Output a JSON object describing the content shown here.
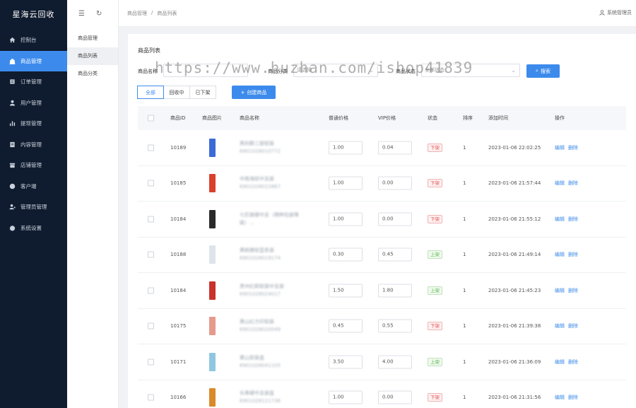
{
  "app": {
    "logo": "星海云回收"
  },
  "sidebar": {
    "items": [
      {
        "label": "控制台",
        "icon": "home-icon",
        "active": false
      },
      {
        "label": "商品管理",
        "icon": "shopping-bag-icon",
        "active": true
      },
      {
        "label": "订单管理",
        "icon": "order-icon",
        "active": false
      },
      {
        "label": "用户管理",
        "icon": "user-icon",
        "active": false
      },
      {
        "label": "提现管理",
        "icon": "bar-chart-icon",
        "active": false
      },
      {
        "label": "内容管理",
        "icon": "document-icon",
        "active": false
      },
      {
        "label": "店铺管理",
        "icon": "store-icon",
        "active": false
      },
      {
        "label": "客户端",
        "icon": "client-icon",
        "active": false
      },
      {
        "label": "管理员管理",
        "icon": "admin-icon",
        "active": false
      },
      {
        "label": "系统设置",
        "icon": "gear-icon",
        "active": false
      }
    ]
  },
  "subnav": {
    "items": [
      {
        "label": "商品管理",
        "active": false
      },
      {
        "label": "商品列表",
        "active": true
      },
      {
        "label": "商品分类",
        "active": false
      }
    ]
  },
  "header": {
    "breadcrumb": [
      "商品管理",
      "/",
      "商品列表"
    ],
    "user": "系统管理员"
  },
  "main": {
    "title": "商品列表",
    "filters": {
      "name_label": "商品名称",
      "category_label": "商品分类",
      "category_placeholder": "请选择",
      "status_label": "商品状态",
      "status_placeholder": "全部状态",
      "search_label": "搜索"
    },
    "watermark": "https://www.huzhan.com/ishop41839",
    "tabs": [
      "全部",
      "回收中",
      "已下架"
    ],
    "create_label": "创建商品",
    "columns": [
      "商品ID",
      "商品图片",
      "商品名称",
      "普通价格",
      "VIP价格",
      "状态",
      "排序",
      "添加时间",
      "操作"
    ],
    "row_actions": {
      "edit": "编辑",
      "delete": "删除"
    },
    "rows": [
      {
        "id": "10189",
        "name": "黑利群三层软装",
        "code": "6901028010772",
        "price": "1.00",
        "vip": "0.04",
        "status": "下架",
        "status_on": false,
        "sort": "1",
        "time": "2023-01-06 22:02:25",
        "thumb": "#3a6bd6"
      },
      {
        "id": "10185",
        "name": "中南海软中支装",
        "code": "6901028022867",
        "price": "1.00",
        "vip": "0.00",
        "status": "下架",
        "status_on": false,
        "sort": "1",
        "time": "2023-01-06 21:57:44",
        "thumb": "#d9412d"
      },
      {
        "id": "10184",
        "name": "七匹狼硬中支（两种包装等级）...",
        "code": "",
        "price": "1.00",
        "vip": "0.00",
        "status": "下架",
        "status_on": false,
        "sort": "1",
        "time": "2023-01-06 21:55:12",
        "thumb": "#2a2a2a"
      },
      {
        "id": "10188",
        "name": "黄鹤楼软蓝条装",
        "code": "6901028019174",
        "price": "0.30",
        "vip": "0.45",
        "status": "上架",
        "status_on": true,
        "sort": "1",
        "time": "2023-01-06 21:49:14",
        "thumb": "#dfe4ea"
      },
      {
        "id": "10184",
        "name": "贵州红鹤软装中支装",
        "code": "6901028024017",
        "price": "1.50",
        "vip": "1.80",
        "status": "上架",
        "status_on": true,
        "sort": "1",
        "time": "2023-01-06 21:45:23",
        "thumb": "#c8322a"
      },
      {
        "id": "10175",
        "name": "黄山红方印软装",
        "code": "6901028020049",
        "price": "0.45",
        "vip": "0.55",
        "status": "下架",
        "status_on": false,
        "sort": "1",
        "time": "2023-01-06 21:39:38",
        "thumb": "#e59a8c"
      },
      {
        "id": "10171",
        "name": "黄山软装盒",
        "code": "6901028041105",
        "price": "3.50",
        "vip": "4.00",
        "status": "上架",
        "status_on": true,
        "sort": "1",
        "time": "2023-01-06 21:36:09",
        "thumb": "#8fc6e0"
      },
      {
        "id": "10166",
        "name": "长寿硬中支装盒",
        "code": "6901028121736",
        "price": "1.00",
        "vip": "0.00",
        "status": "下架",
        "status_on": false,
        "sort": "1",
        "time": "2023-01-06 21:31:56",
        "thumb": "#d98a2a"
      }
    ]
  }
}
